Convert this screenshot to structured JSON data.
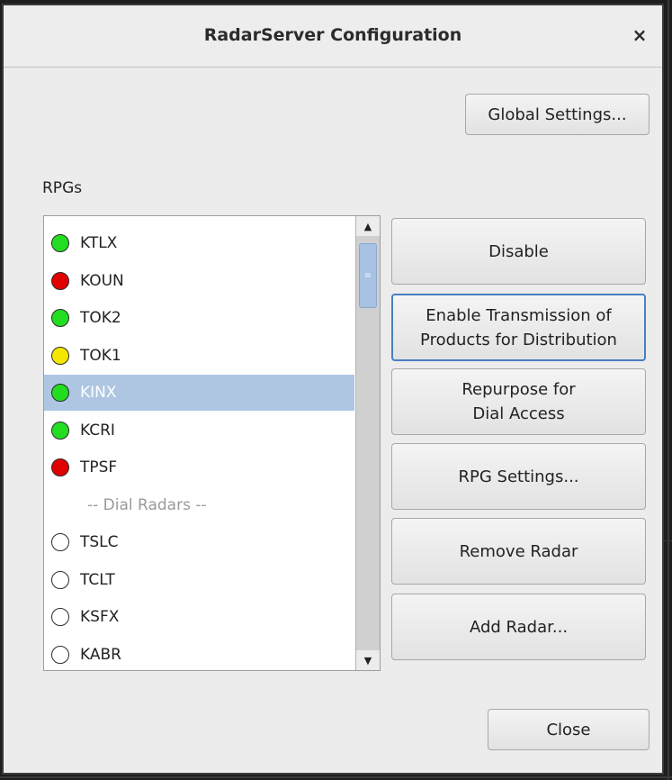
{
  "dialog": {
    "title": "RadarServer Configuration",
    "close_icon": "×"
  },
  "buttons": {
    "global_settings": "Global Settings...",
    "disable": "Disable",
    "enable_transmission": "Enable Transmission of\nProducts for Distribution",
    "repurpose": "Repurpose for\nDial Access",
    "rpg_settings": "RPG Settings...",
    "remove_radar": "Remove Radar",
    "add_radar": "Add Radar...",
    "close": "Close"
  },
  "rpgs": {
    "label": "RPGs",
    "items": [
      {
        "name": "KTLX",
        "status_color": "#22dd22",
        "selected": false
      },
      {
        "name": "KOUN",
        "status_color": "#e00000",
        "selected": false
      },
      {
        "name": "TOK2",
        "status_color": "#22dd22",
        "selected": false
      },
      {
        "name": "TOK1",
        "status_color": "#f5e600",
        "selected": false
      },
      {
        "name": "KINX",
        "status_color": "#22dd22",
        "selected": true
      },
      {
        "name": "KCRI",
        "status_color": "#22dd22",
        "selected": false
      },
      {
        "name": "TPSF",
        "status_color": "#e00000",
        "selected": false
      }
    ],
    "separator": "-- Dial Radars --",
    "dial_items": [
      {
        "name": "TSLC",
        "status_color": "#ffffff"
      },
      {
        "name": "TCLT",
        "status_color": "#ffffff"
      },
      {
        "name": "KSFX",
        "status_color": "#ffffff"
      },
      {
        "name": "KABR",
        "status_color": "#ffffff"
      }
    ]
  },
  "scrollbar": {
    "up_icon": "▲",
    "down_icon": "▼",
    "grip_icon": "≡"
  }
}
